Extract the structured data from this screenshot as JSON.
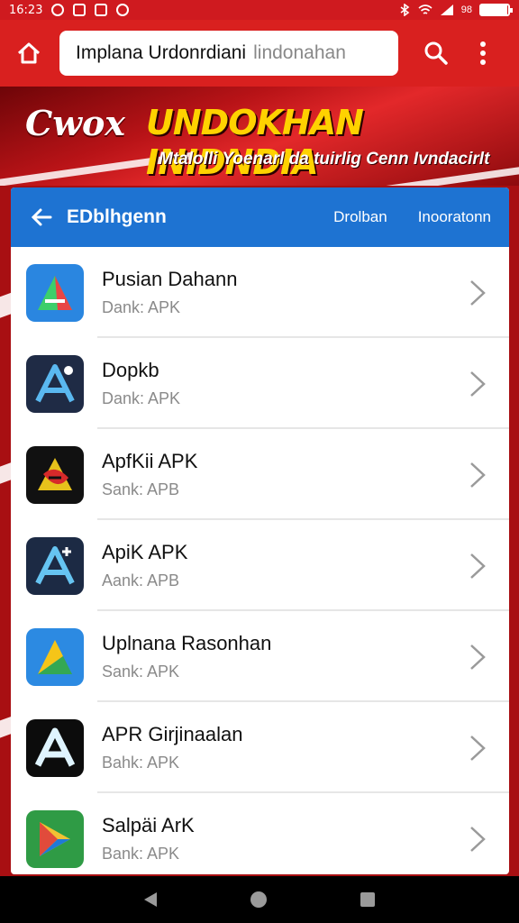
{
  "status_bar": {
    "time": "16:23",
    "icons": [
      "notification-icon",
      "photo-icon",
      "download-icon",
      "sync-icon",
      "bluetooth-icon",
      "wifi-icon",
      "signal-icon"
    ],
    "battery_text": "98"
  },
  "toolbar": {
    "url_text": "Implana Urdonrdiani",
    "url_hint": "lindonahan"
  },
  "banner": {
    "logo": "Cwox",
    "title": "UNDOKHAN INIDNDIA",
    "subtitle": "Mtalolli Yoenarl da tuirlig Cenn Ivndacirlt"
  },
  "panel": {
    "header": {
      "title": "EDblhgenn",
      "tab1": "Drolban",
      "tab2": "Inooratonn"
    },
    "apps": [
      {
        "name": "Pusian Dahann",
        "sub": "Dank: APK",
        "icon": "play-triangle-icon"
      },
      {
        "name": "Dopkb",
        "sub": "Dank: APK",
        "icon": "a-logo-blue-icon"
      },
      {
        "name": "ApfKii APK",
        "sub": "Sank: APB",
        "icon": "a-logo-yellow-icon"
      },
      {
        "name": "ApiK APK",
        "sub": "Aank: APB",
        "icon": "a-logo-plus-icon"
      },
      {
        "name": "Uplnana Rasonhan",
        "sub": "Sank: APK",
        "icon": "triangle-multicolor-icon"
      },
      {
        "name": "APR Girjinaalan",
        "sub": "Bahk: APK",
        "icon": "a-logo-black-icon"
      },
      {
        "name": "Salpäi ArK",
        "sub": "Bank: APK",
        "icon": "play-store-icon"
      }
    ]
  },
  "colors": {
    "toolbar": "#d9201f",
    "header": "#1e73d2",
    "banner_title": "#ffd200"
  }
}
